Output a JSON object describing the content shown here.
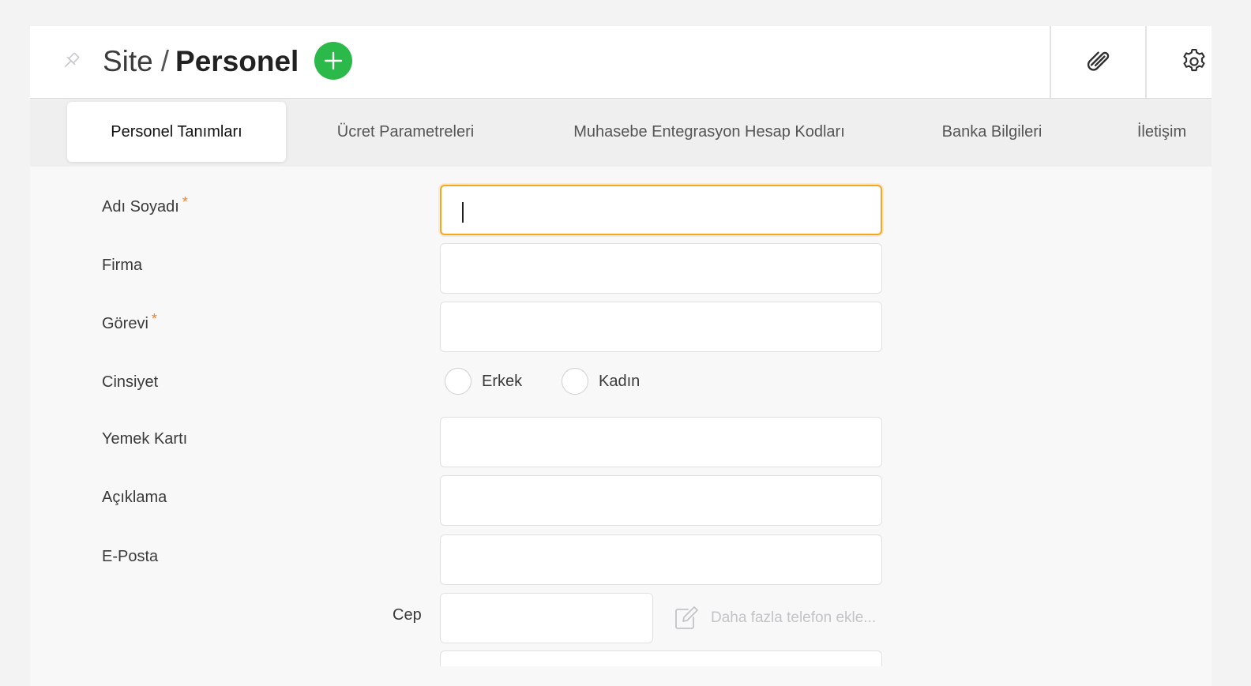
{
  "header": {
    "site": "Site",
    "separator": "/",
    "title": "Personel",
    "icons": {
      "pin": "pin-icon",
      "add": "plus-icon",
      "attachment": "paperclip-icon",
      "settings": "gear-icon"
    },
    "add_color": "#2bb94a"
  },
  "tabs": [
    {
      "label": "Personel Tanımları",
      "active": true
    },
    {
      "label": "Ücret Parametreleri",
      "active": false
    },
    {
      "label": "Muhasebe Entegrasyon Hesap Kodları",
      "active": false
    },
    {
      "label": "Banka Bilgileri",
      "active": false
    },
    {
      "label": "İletişim",
      "active": false
    }
  ],
  "form": {
    "required_marker": "*",
    "fields": {
      "full_name": {
        "label": "Adı Soyadı",
        "value": "",
        "required": true,
        "focused": true
      },
      "company": {
        "label": "Firma",
        "value": ""
      },
      "position": {
        "label": "Görevi",
        "value": "",
        "required": true
      },
      "gender": {
        "label": "Cinsiyet",
        "options": [
          "Erkek",
          "Kadın"
        ],
        "selected": null
      },
      "meal_card": {
        "label": "Yemek Kartı",
        "value": ""
      },
      "description": {
        "label": "Açıklama",
        "value": ""
      },
      "email": {
        "label": "E-Posta",
        "value": ""
      },
      "mobile": {
        "label": "Cep",
        "value": ""
      }
    },
    "more_phone": "Daha fazla telefon ekle..."
  },
  "colors": {
    "focus": "#f5a623",
    "required": "#f0822a"
  }
}
